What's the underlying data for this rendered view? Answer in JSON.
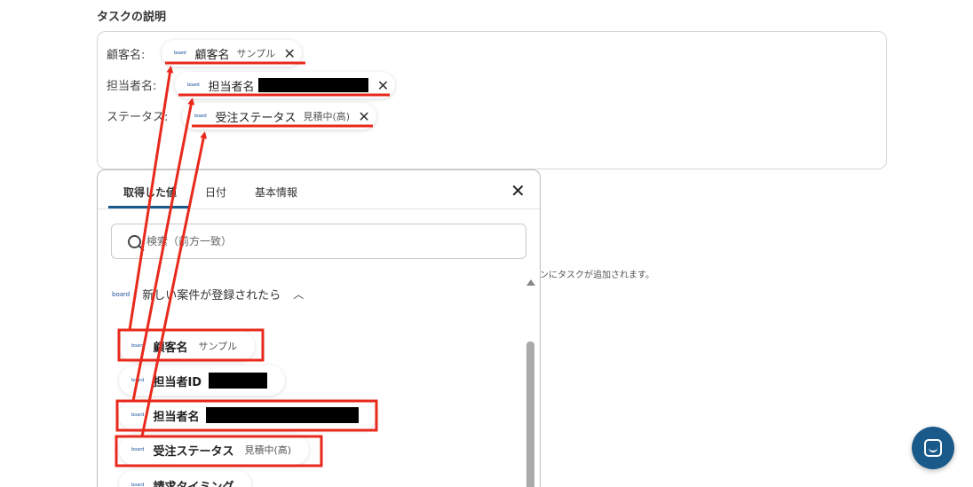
{
  "section": {
    "title": "タスクの説明"
  },
  "description": {
    "fields": [
      {
        "label": "顧客名:",
        "chip_logo": "board",
        "chip_name": "顧客名",
        "chip_sample": "サンプル"
      },
      {
        "label": "担当者名:",
        "chip_logo": "board",
        "chip_name": "担当者名",
        "chip_sample": ""
      },
      {
        "label": "ステータス:",
        "chip_logo": "board",
        "chip_name": "受注ステータス",
        "chip_sample": "見積中(高)"
      }
    ],
    "remove_glyph": "✕"
  },
  "hint_text": "ンにタスクが追加されます。",
  "panel": {
    "tabs": [
      {
        "label": "取得した値"
      },
      {
        "label": "日付"
      },
      {
        "label": "基本情報"
      }
    ],
    "close_glyph": "✕",
    "search": {
      "placeholder": "検索（前方一致）"
    },
    "group": {
      "logo": "board",
      "title": "新しい案件が登録されたら",
      "chevron": "︿"
    },
    "items": [
      {
        "logo": "board",
        "name": "顧客名",
        "sample": "サンプル"
      },
      {
        "logo": "board",
        "name": "担当者ID",
        "sample": ""
      },
      {
        "logo": "board",
        "name": "担当者名",
        "sample": ""
      },
      {
        "logo": "board",
        "name": "受注ステータス",
        "sample": "見積中(高)"
      },
      {
        "logo": "board",
        "name": "請求タイミング",
        "sample": ""
      }
    ]
  },
  "colors": {
    "accent": "#1a5a8a",
    "annotation": "#e8291c"
  }
}
